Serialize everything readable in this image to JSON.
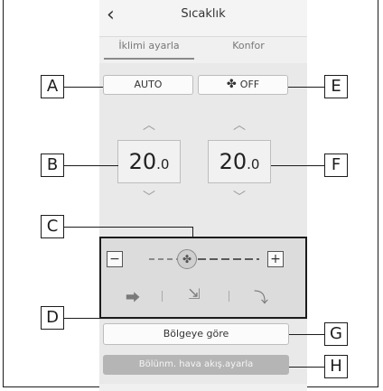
{
  "header": {
    "title": "Sıcaklık",
    "back_glyph": "‹"
  },
  "tabs": [
    {
      "label": "İklimi ayarla",
      "active": true
    },
    {
      "label": "Konfor",
      "active": false
    }
  ],
  "buttons": {
    "auto": "AUTO",
    "fan_off": "OFF",
    "fan_icon": "fan-icon",
    "zone": "Bölgeye göre",
    "split_airflow": "Bölünm. hava akış.ayarla"
  },
  "temperature": {
    "left": {
      "whole": "20",
      "decimal": ".0"
    },
    "right": {
      "whole": "20",
      "decimal": ".0"
    }
  },
  "fan_speed": {
    "minus": "−",
    "plus": "+",
    "level": 0
  },
  "callouts": {
    "A": "A",
    "B": "B",
    "C": "C",
    "D": "D",
    "E": "E",
    "F": "F",
    "G": "G",
    "H": "H"
  },
  "colors": {
    "panel": "#e9e9e9",
    "disabled_button": "#b5b5b5"
  }
}
